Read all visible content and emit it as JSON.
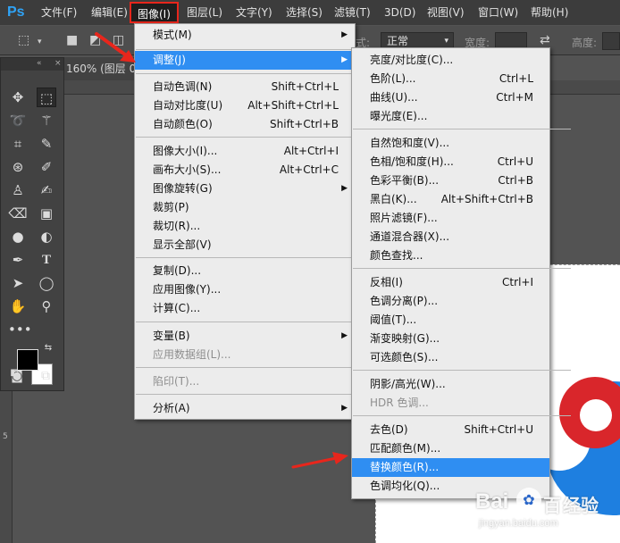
{
  "app": {
    "logo": "Ps"
  },
  "menubar": {
    "items": [
      {
        "label": "文件(F)"
      },
      {
        "label": "编辑(E)"
      },
      {
        "label": "图像(I)"
      },
      {
        "label": "图层(L)"
      },
      {
        "label": "文字(Y)"
      },
      {
        "label": "选择(S)"
      },
      {
        "label": "滤镜(T)"
      },
      {
        "label": "3D(D)"
      },
      {
        "label": "视图(V)"
      },
      {
        "label": "窗口(W)"
      },
      {
        "label": "帮助(H)"
      }
    ],
    "active_index": 2
  },
  "options": {
    "style_label": "式:",
    "style_value": "正常",
    "width_label": "宽度:",
    "height_label": "高度:"
  },
  "document": {
    "tab_label": "160% (图层 0"
  },
  "ruler": {
    "left_numbers": [
      "1",
      "2",
      "3",
      "4",
      "5"
    ]
  },
  "image_menu": {
    "items": [
      {
        "label": "模式(M)",
        "submenu": true
      },
      {
        "label": "调整(J)",
        "submenu": true,
        "highlighted": true
      },
      {
        "label": "自动色调(N)",
        "shortcut": "Shift+Ctrl+L"
      },
      {
        "label": "自动对比度(U)",
        "shortcut": "Alt+Shift+Ctrl+L"
      },
      {
        "label": "自动颜色(O)",
        "shortcut": "Shift+Ctrl+B"
      },
      {
        "label": "图像大小(I)...",
        "shortcut": "Alt+Ctrl+I"
      },
      {
        "label": "画布大小(S)...",
        "shortcut": "Alt+Ctrl+C"
      },
      {
        "label": "图像旋转(G)",
        "submenu": true
      },
      {
        "label": "裁剪(P)"
      },
      {
        "label": "裁切(R)..."
      },
      {
        "label": "显示全部(V)"
      },
      {
        "label": "复制(D)..."
      },
      {
        "label": "应用图像(Y)..."
      },
      {
        "label": "计算(C)..."
      },
      {
        "label": "变量(B)",
        "submenu": true
      },
      {
        "label": "应用数据组(L)...",
        "disabled": true
      },
      {
        "label": "陷印(T)...",
        "disabled": true
      },
      {
        "label": "分析(A)",
        "submenu": true
      }
    ]
  },
  "adjust_menu": {
    "items": [
      {
        "label": "亮度/对比度(C)..."
      },
      {
        "label": "色阶(L)...",
        "shortcut": "Ctrl+L"
      },
      {
        "label": "曲线(U)...",
        "shortcut": "Ctrl+M"
      },
      {
        "label": "曝光度(E)..."
      },
      {
        "label": "自然饱和度(V)..."
      },
      {
        "label": "色相/饱和度(H)...",
        "shortcut": "Ctrl+U"
      },
      {
        "label": "色彩平衡(B)...",
        "shortcut": "Ctrl+B"
      },
      {
        "label": "黑白(K)...",
        "shortcut": "Alt+Shift+Ctrl+B"
      },
      {
        "label": "照片滤镜(F)..."
      },
      {
        "label": "通道混合器(X)..."
      },
      {
        "label": "颜色查找..."
      },
      {
        "label": "反相(I)",
        "shortcut": "Ctrl+I"
      },
      {
        "label": "色调分离(P)..."
      },
      {
        "label": "阈值(T)..."
      },
      {
        "label": "渐变映射(G)..."
      },
      {
        "label": "可选颜色(S)..."
      },
      {
        "label": "阴影/高光(W)..."
      },
      {
        "label": "HDR 色调...",
        "disabled": true
      },
      {
        "label": "去色(D)",
        "shortcut": "Shift+Ctrl+U"
      },
      {
        "label": "匹配颜色(M)..."
      },
      {
        "label": "替换颜色(R)...",
        "highlighted": true
      },
      {
        "label": "色调均化(Q)..."
      }
    ]
  },
  "watermark": {
    "brand": "Bai",
    "brand2": "百",
    "suffix": "经验",
    "url": "jingyan.baidu.com"
  },
  "colors": {
    "highlight": "#2f8ef2",
    "annotation": "#e8261c",
    "menu_bg": "#ececec"
  }
}
